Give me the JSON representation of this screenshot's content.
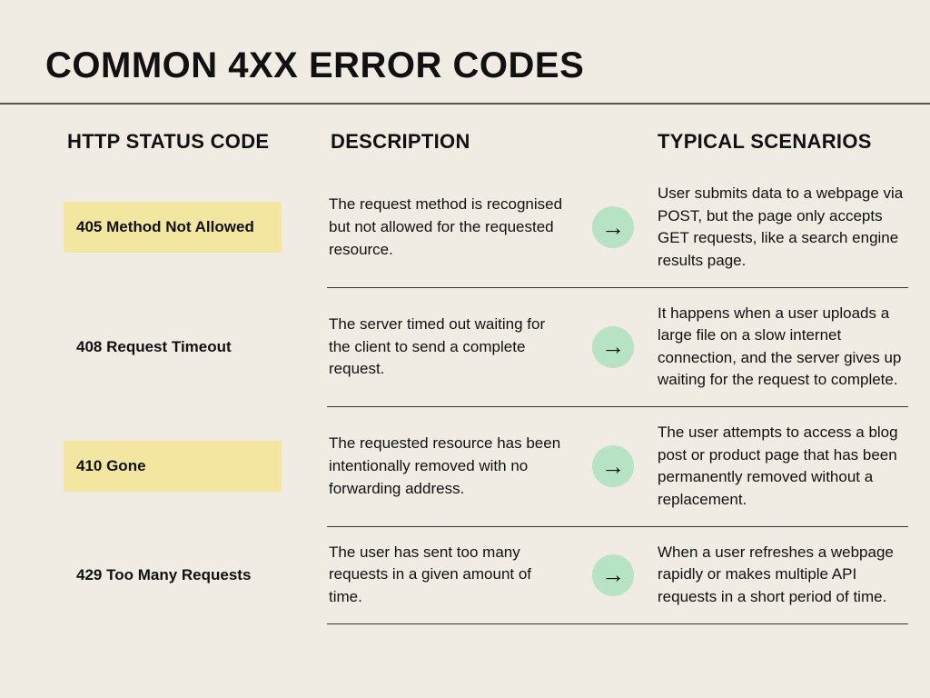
{
  "title": "COMMON 4XX ERROR CODES",
  "headers": {
    "code": "HTTP STATUS CODE",
    "description": "DESCRIPTION",
    "scenarios": "TYPICAL SCENARIOS"
  },
  "arrow_glyph": "→",
  "chart_data": {
    "type": "table",
    "columns": [
      "HTTP STATUS CODE",
      "DESCRIPTION",
      "TYPICAL SCENARIOS"
    ],
    "rows": [
      {
        "code": "405 Method Not Allowed",
        "highlighted": true,
        "description": "The request method is recognised but not allowed for the requested resource.",
        "scenario": "User submits data to a webpage via POST, but the page only accepts GET requests, like a search engine results page."
      },
      {
        "code": "408 Request Timeout",
        "highlighted": false,
        "description": "The server timed out waiting for the client to send a complete request.",
        "scenario": "It happens when a user uploads a large file on a slow internet connection, and the server gives up waiting for the request to complete."
      },
      {
        "code": "410 Gone",
        "highlighted": true,
        "description": "The requested resource has been intentionally removed with no forwarding address.",
        "scenario": "The user attempts to access a blog post or product page that has been permanently removed without a replacement."
      },
      {
        "code": "429 Too Many Requests",
        "highlighted": false,
        "description": "The user has sent too many requests in a given amount of time.",
        "scenario": "When a user refreshes a webpage rapidly or makes multiple API requests in a short period of time."
      }
    ]
  }
}
